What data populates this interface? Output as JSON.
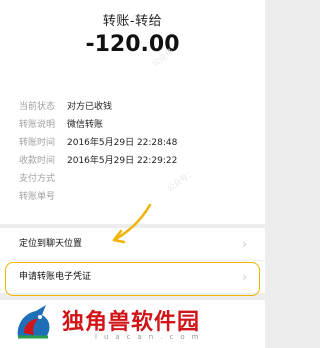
{
  "header": {
    "title": "转账-转给",
    "amount": "-120.00"
  },
  "details": [
    {
      "label": "当前状态",
      "value": "对方已收钱"
    },
    {
      "label": "转账说明",
      "value": "微信转账"
    },
    {
      "label": "转账时间",
      "value": "2016年5月29日 22:28:48"
    },
    {
      "label": "收款时间",
      "value": "2016年5月29日 22:29:22"
    },
    {
      "label": "支付方式",
      "value": ""
    },
    {
      "label": "转账单号",
      "value": ""
    }
  ],
  "actions": [
    {
      "label": "定位到聊天位置",
      "icon": "chevron-right-icon"
    },
    {
      "label": "申请转账电子凭证",
      "icon": "chevron-right-icon"
    }
  ],
  "watermark": "公众号：",
  "branding": {
    "name": "独角兽软件园",
    "domain": "luacan.com"
  },
  "colors": {
    "highlight": "#f2b200",
    "brand_red": "#d01418"
  }
}
